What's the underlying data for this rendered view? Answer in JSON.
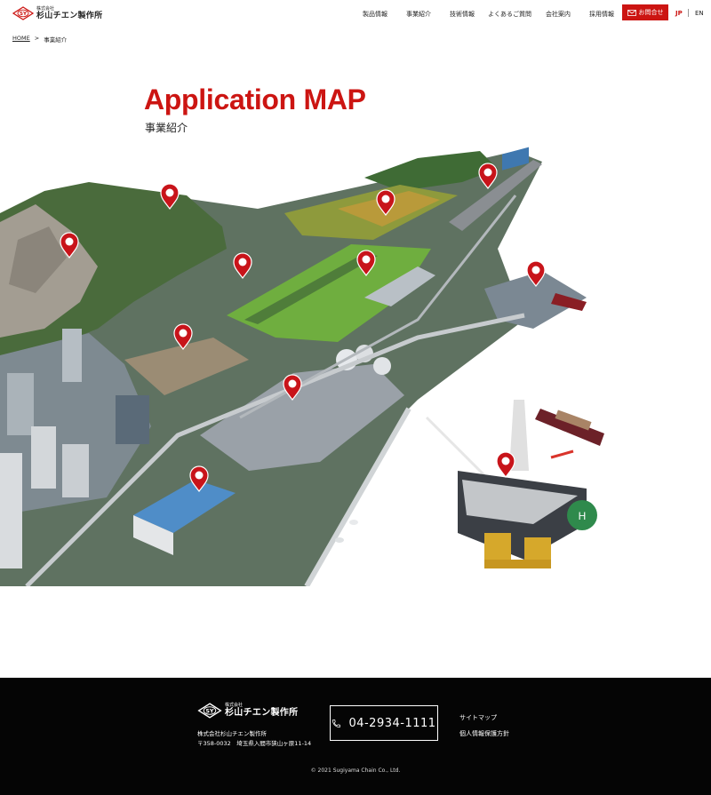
{
  "header": {
    "logo_small": "株式会社",
    "logo_name": "杉山チエン製作所",
    "nav": [
      "製品情報",
      "事業紹介",
      "技術情報",
      "よくあるご質問",
      "会社案内",
      "採用情報"
    ],
    "contact_label": "お問合せ",
    "lang_jp": "JP",
    "lang_en": "EN"
  },
  "breadcrumb": {
    "home": "HOME",
    "separator": ">",
    "current": "事業紹介"
  },
  "page": {
    "title": "Application MAP",
    "subtitle": "事業紹介"
  },
  "map": {
    "pin_count": 12,
    "helipad_letter": "H"
  },
  "footer": {
    "logo_small": "株式会社",
    "logo_name": "杉山チエン製作所",
    "company": "株式会社杉山チエン製作所",
    "address": "〒358-0032　埼玉県入間市狭山ヶ原11-14",
    "phone": "04-2934-1111",
    "link_sitemap": "サイトマップ",
    "link_privacy": "個人情報保護方針",
    "copyright": "© 2021 Sugiyama Chain Co., Ltd."
  },
  "colors": {
    "accent": "#cc1512",
    "footer_bg": "#050505"
  }
}
